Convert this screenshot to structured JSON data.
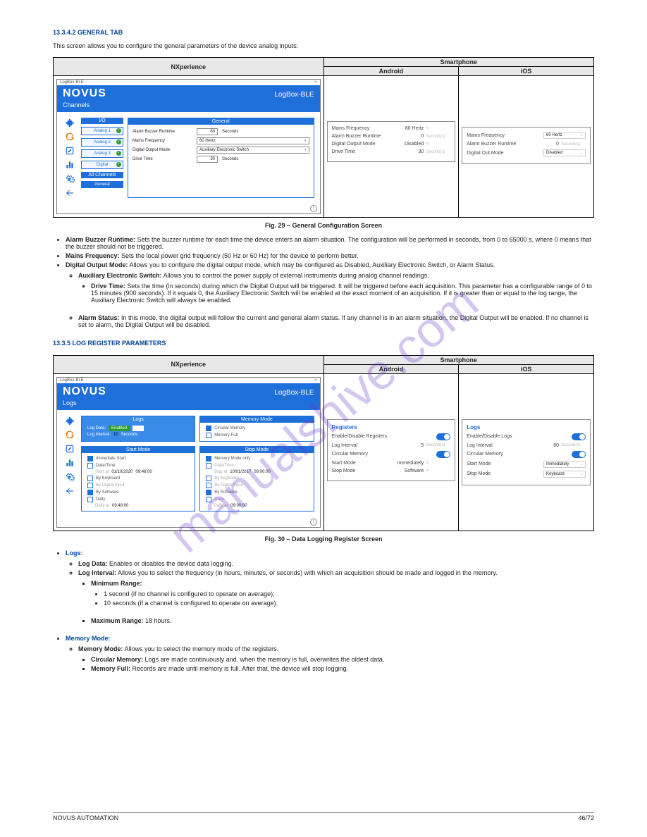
{
  "header_smart": {
    "title": "NXperience",
    "subtitle": "Smartphone"
  },
  "intro1": {
    "section": "13.3.4.2   GENERAL TAB",
    "preline": "This screen allows you to configure the general parameters of the device analog inputs:"
  },
  "nxs1": {
    "title": "LogBox-BLE",
    "header_brand": "NOVUS",
    "header_device": "LogBox-BLE",
    "header_section": "Channels",
    "close": "×",
    "io": "I/O",
    "channels": [
      "Analog 1",
      "Analog 2",
      "Analog 3",
      "Digital"
    ],
    "all": "All Channels",
    "general": "General",
    "pane": "General",
    "rows": [
      {
        "l": "Alarm Buzzer Runtime",
        "n": "60",
        "u": "Seconds"
      },
      {
        "l": "Mains Frequency",
        "v": "60 Hertz"
      },
      {
        "l": "Digital Output Mode",
        "v": "Auxiliary Electronic Switch"
      },
      {
        "l": "Drive Time",
        "n": "30",
        "u": "Seconds"
      }
    ],
    "help": "i"
  },
  "android1": {
    "head": "Android",
    "rows": [
      {
        "l": "Mains Frequency",
        "v": "60 Hertz",
        "pencil": true
      },
      {
        "l": "Alarm Buzzer Runtime",
        "v": "0",
        "u": "Second(s)"
      },
      {
        "l": "Digital Output Mode",
        "v": "Disabled",
        "pencil": true
      },
      {
        "l": "Drive Time",
        "v": "30",
        "u": "Second(s)",
        "dis": true
      }
    ]
  },
  "ios1": {
    "head": "iOS",
    "rows": [
      {
        "l": "Mains Frequency",
        "v": "60 Hertz",
        "dd": true
      },
      {
        "l": "Alarm Buzzer Runtime",
        "v": "0",
        "u": "Second(s)"
      },
      {
        "l": "Digital Out Mode",
        "v": "Disabled",
        "dd": true
      }
    ]
  },
  "fig29": "Fig. 29 – General Configuration Screen",
  "bullets1": [
    {
      "b": "Alarm Buzzer Runtime:",
      "t": "Sets the buzzer runtime for each time the device enters an alarm situation. The configuration will be performed in seconds, from 0 to 65000 s, where 0 means that the buzzer should not be triggered."
    },
    {
      "b": "Mains Frequency:",
      "t": "Sets the local power grid frequency (50 Hz or 60 Hz) for the device to perform better."
    },
    {
      "b": "Digital Output Mode:",
      "t": "Allows you to configure the digital output mode, which may be configured as Disabled, Auxiliary Electronic Switch, or Alarm Status."
    },
    {
      "sub": [
        {
          "b": "Auxiliary Electronic Switch:",
          "t": "Allows you to control the power supply of external instruments during analog channel readings."
        },
        {
          "b": "Drive Time:",
          "t": "Sets the time (in seconds) during which the Digital Output will be triggered. It will be triggered before each acquisition. This parameter has a configurable range of 0 to 15 minutes (900 seconds). If it equals 0, the Auxiliary Electronic Switch will be enabled at the exact moment of an acquisition. If it is greater than or equal to the log range, the Auxiliary Electronic Switch will always be enabled."
        },
        {
          "b": "Alarm Status:",
          "t": "In this mode, the digital output will follow the current and general alarm status. If any channel is in an alarm situation, the Digital Output will be enabled. If no channel is set to alarm, the Digital Output will be disabled."
        }
      ]
    }
  ],
  "intro2": {
    "section": "13.3.5   LOG REGISTER PARAMETERS"
  },
  "nxs2": {
    "title": "LogBox-BLE",
    "header_brand": "NOVUS",
    "header_device": "LogBox-BLE",
    "header_section": "Logs",
    "close": "×",
    "help": "i",
    "logs_head": "Logs",
    "logs_rows": [
      {
        "l": "Log Data:",
        "b": "Enabled"
      },
      {
        "l": "Log Interval:",
        "v": "10",
        "u": "Seconds"
      }
    ],
    "mm_head": "Memory Mode",
    "mm_rows": [
      {
        "sel": true,
        "t": "Circular Memory"
      },
      {
        "sel": false,
        "t": "Memory Full"
      }
    ],
    "sm_head": "Start Mode",
    "sm_rows": [
      {
        "on": true,
        "t": "Immediate Start"
      },
      {
        "on": false,
        "t": "Date/Time",
        "sub": "Start at",
        "d": "01/10/2020",
        "tm": "09:48:00"
      },
      {
        "on": false,
        "t": "By Keyboard"
      },
      {
        "on": false,
        "t": "By Digital Input",
        "dis": true
      },
      {
        "on": true,
        "t": "By Software"
      },
      {
        "on": false,
        "t": "Daily",
        "sub": "Daily at",
        "tm": "09:48:00"
      }
    ],
    "stp_head": "Stop Mode",
    "stp_rows": [
      {
        "on": true,
        "t": "Memory Mode only"
      },
      {
        "on": false,
        "t": "Date/Time",
        "sub": "Stop at",
        "d": "10/01/2017",
        "tm": "09:00:00",
        "dis": true
      },
      {
        "on": false,
        "t": "By Keyboard",
        "dis": true
      },
      {
        "on": false,
        "t": "By Digital Input",
        "dis": true
      },
      {
        "on": true,
        "t": "By Software"
      },
      {
        "on": false,
        "t": "Daily",
        "sub": "Daily at",
        "tm": "09:00:00",
        "dis": true
      }
    ]
  },
  "android2": {
    "head": "Android",
    "title": "Registers",
    "rows": [
      {
        "l": "Enable/Disable Registers",
        "toggle": true
      },
      {
        "l": "Log Interval",
        "v": "5",
        "u": "Second(s)"
      },
      {
        "l": "Circular Memory",
        "toggle": true
      },
      {
        "l": "Start Mode",
        "v": "Immediately",
        "pencil": true
      },
      {
        "l": "Stop Mode",
        "v": "Software",
        "pencil": true
      }
    ]
  },
  "ios2": {
    "head": "iOS",
    "title": "Logs",
    "rows": [
      {
        "l": "Enable/Disable Logs",
        "toggle": true
      },
      {
        "l": "Log Interval",
        "v": "60",
        "u": "Second(s)"
      },
      {
        "l": "Circular Memory",
        "toggle": true
      },
      {
        "l": "Start Mode",
        "v": "Immediately",
        "dd": true
      },
      {
        "l": "Stop Mode",
        "v": "Keyboard",
        "dd": true
      }
    ]
  },
  "fig30": "Fig. 30 – Data Logging Register Screen",
  "bullets2": [
    {
      "b": "Logs:",
      "t": ""
    },
    {
      "sub": [
        {
          "b": "Log Data:",
          "t": "Enables or disables the device data logging."
        },
        {
          "b": "Log Interval:",
          "t": "Allows you to select the frequency (in hours, minutes, or seconds) with which an acquisition should be made and logged in the memory."
        },
        {
          "sub": [
            {
              "b": "Minimum Range:",
              "t": ""
            },
            {
              "sub": [
                {
                  "p": "1 second (if no channel is configured to operate on average);"
                },
                {
                  "p": "10 seconds (if a channel is configured to operate on average)."
                }
              ]
            },
            {
              "b": "Maximum Range:",
              "t": "18 hours."
            }
          ]
        }
      ]
    },
    {
      "b": "Memory Mode:",
      "t": ""
    },
    {
      "sub": [
        {
          "b": "Memory Mode:",
          "t": "Allows you to select the memory mode of the registers."
        },
        {
          "sub": [
            {
              "b": "Circular Memory:",
              "t": "Logs are made continuously and, when the memory is full, overwrites the oldest data."
            },
            {
              "b": "Memory Full:",
              "t": "Records are made until memory is full. After that, the device will stop logging."
            }
          ]
        }
      ]
    }
  ],
  "footer": {
    "l": "NOVUS AUTOMATION",
    "r": "46/72"
  },
  "wm": "manualshive.com"
}
